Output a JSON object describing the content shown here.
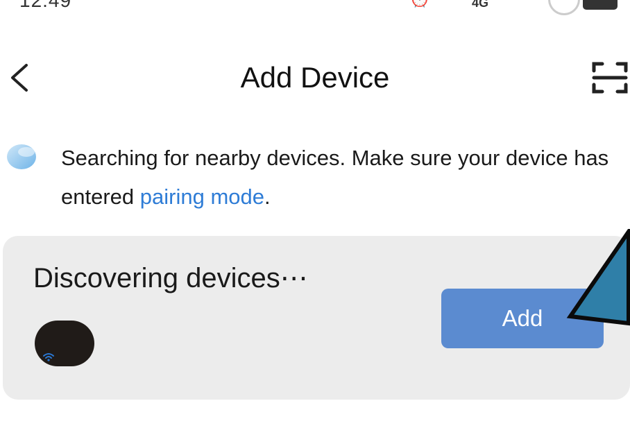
{
  "status_bar": {
    "time": "12:49",
    "network": "4G"
  },
  "header": {
    "title": "Add Device"
  },
  "search": {
    "text_before": "Searching for nearby devices. Make sure your device has entered ",
    "link_text": "pairing mode",
    "text_after": "."
  },
  "card": {
    "title": "Discovering devices⋯",
    "add_label": "Add"
  },
  "colors": {
    "accent": "#5b8bd0",
    "link": "#2e7cd6",
    "card_bg": "#ececec"
  }
}
